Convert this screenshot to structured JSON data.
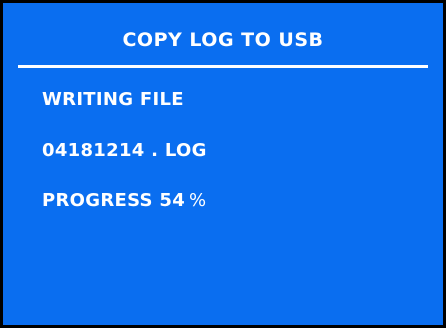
{
  "screen": {
    "title": "COPY LOG TO USB",
    "status_text": "WRITING FILE",
    "file_name": "04181214 . LOG",
    "progress_label": "PROGRESS",
    "progress_value": "54",
    "progress_unit": "%",
    "progress_fraction": 0.54
  },
  "colors": {
    "background": "#0a6ef0",
    "text": "#ffffff",
    "border": "#000000"
  }
}
